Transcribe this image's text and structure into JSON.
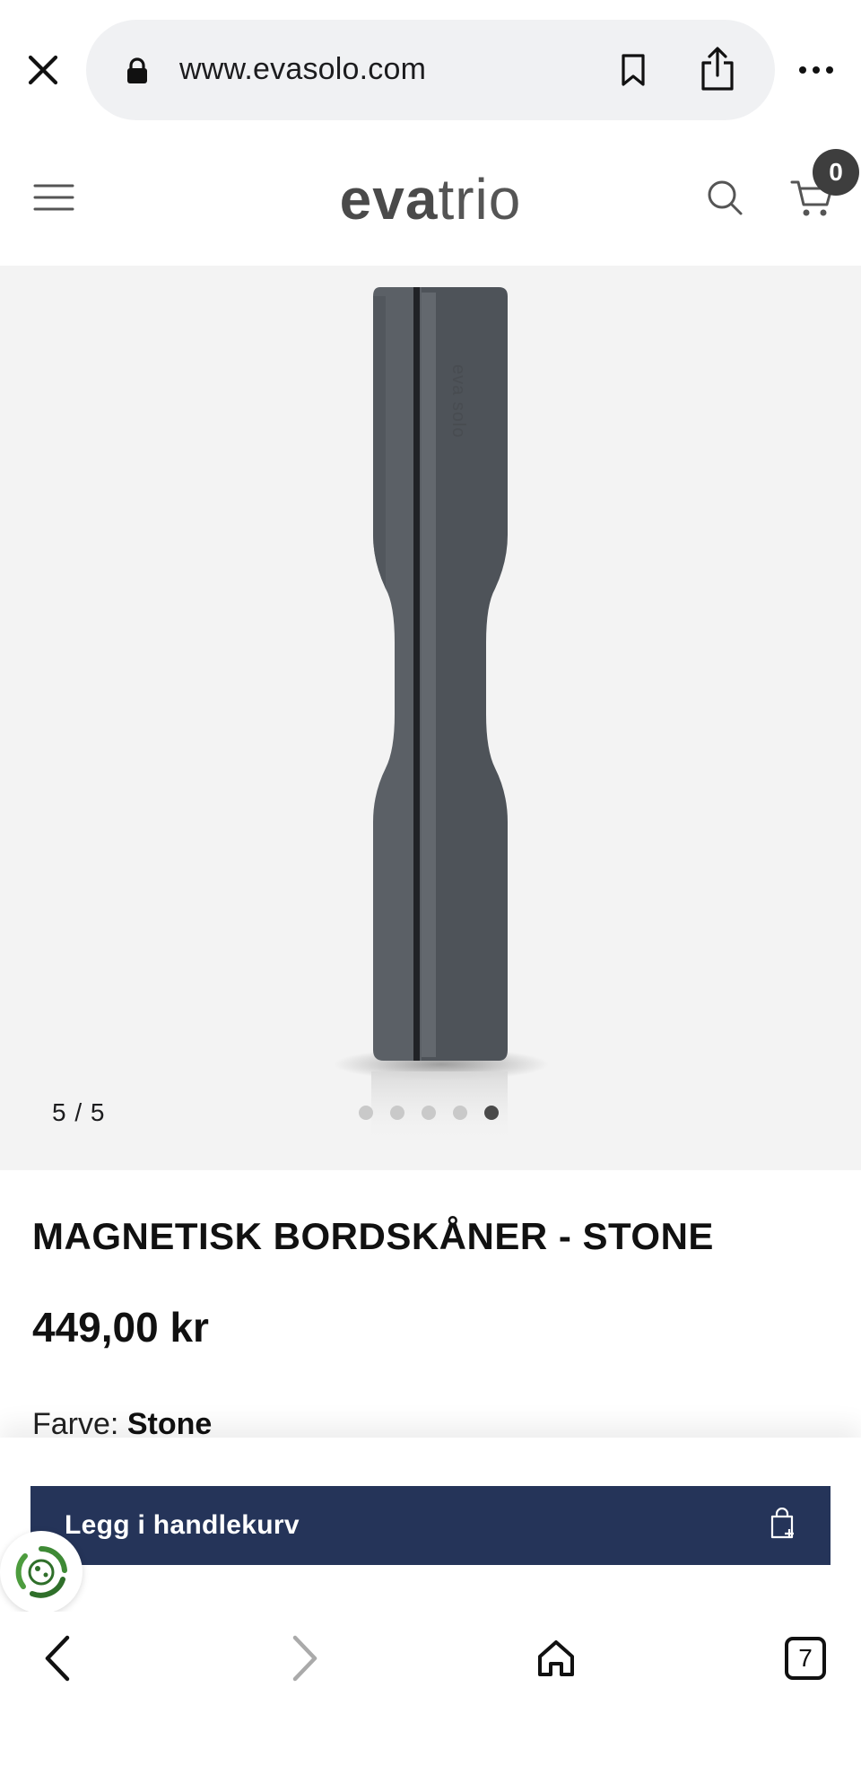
{
  "browser": {
    "url": "www.evasolo.com"
  },
  "header": {
    "logo_part1": "eva",
    "logo_part2": "trio",
    "cart_count": "0"
  },
  "gallery": {
    "slide_counter": "5 / 5",
    "dot_count": 5,
    "active_dot": 5,
    "product_brand_print": "eva solo"
  },
  "product": {
    "title": "MAGNETISK BORDSKÅNER - STONE",
    "price": "449,00 kr",
    "color_label": "Farve:",
    "color_value": "Stone"
  },
  "actions": {
    "add_to_cart_label": "Legg i handlekurv"
  },
  "toolbar": {
    "tabs_count": "7"
  },
  "colors": {
    "cta_background": "#253459",
    "gallery_background": "#f3f3f3",
    "product_color": "#5b6066"
  }
}
